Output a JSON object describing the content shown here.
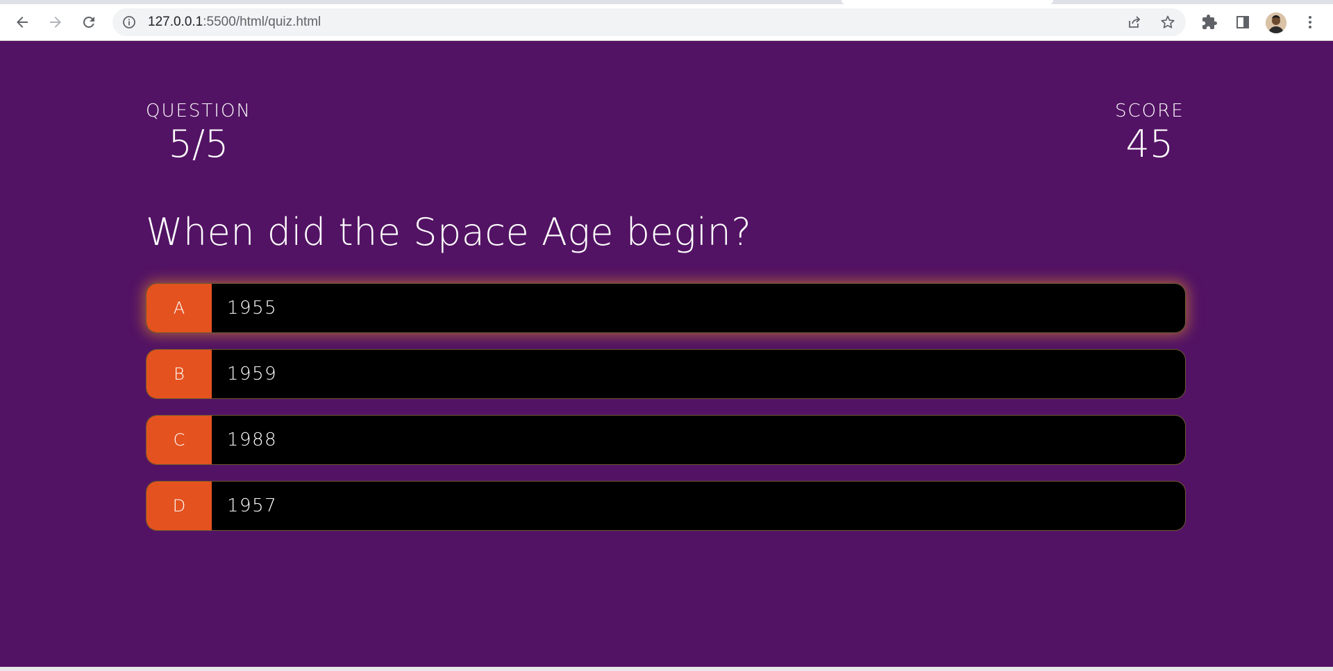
{
  "browser": {
    "url_host": "127.0.0.1",
    "url_rest": ":5500/html/quiz.html",
    "icons": {
      "back": "arrow-left-icon",
      "forward": "arrow-right-icon",
      "reload": "reload-icon",
      "site_info": "info-icon",
      "share": "share-icon",
      "bookmark": "star-icon",
      "extensions": "puzzle-icon",
      "side_panel": "side-panel-icon",
      "menu": "kebab-menu-icon"
    }
  },
  "colors": {
    "page_background": "#531364",
    "prefix_background": "#e4521f",
    "choice_background": "#000000",
    "text": "#ffffff"
  },
  "hud": {
    "question_label": "QUESTION",
    "question_value": "5/5",
    "score_label": "SCORE",
    "score_value": "45"
  },
  "question": "When did the Space Age begin?",
  "choices": [
    {
      "prefix": "A",
      "text": "1955"
    },
    {
      "prefix": "B",
      "text": "1959"
    },
    {
      "prefix": "C",
      "text": "1988"
    },
    {
      "prefix": "D",
      "text": "1957"
    }
  ]
}
